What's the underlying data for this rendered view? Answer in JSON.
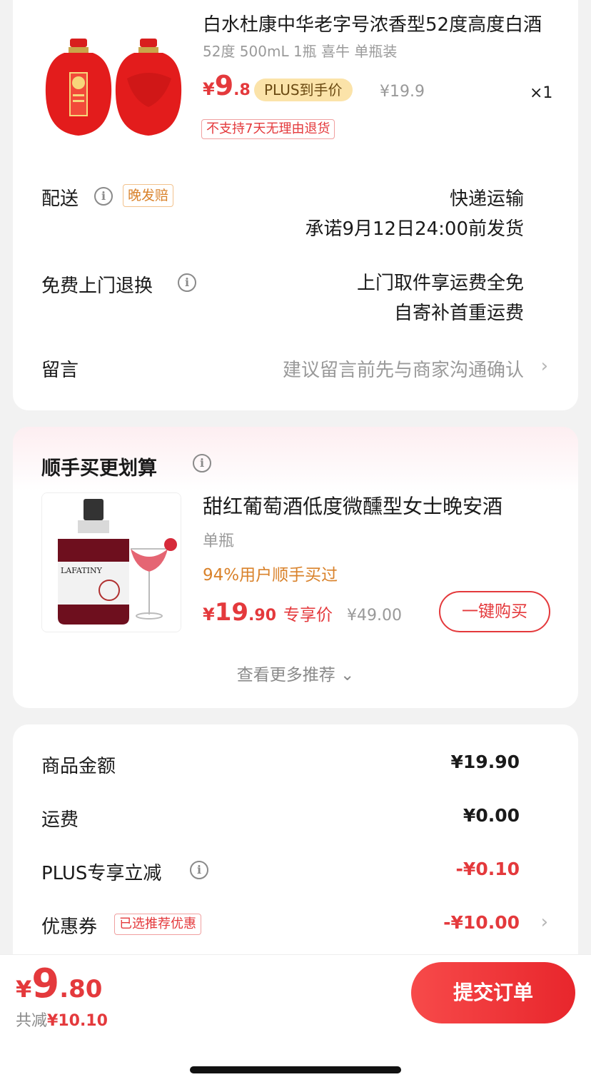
{
  "product": {
    "title": "白水杜康中华老字号浓香型52度高度白酒",
    "spec": "52度 500mL 1瓶 喜牛 单瓶装",
    "price_yen": "¥",
    "price_int": "9",
    "price_dec": ".8",
    "plus_tag": "PLUS到手价",
    "original_price": "¥19.9",
    "quantity": "×1",
    "return_notice": "不支持7天无理由退货"
  },
  "delivery": {
    "label": "配送",
    "tag": "晚发赔",
    "method": "快递运输",
    "promise": "承诺9月12日24:00前发货"
  },
  "exchange": {
    "label": "免费上门退换",
    "line1": "上门取件享运费全免",
    "line2": "自寄补首重运费"
  },
  "message": {
    "label": "留言",
    "placeholder": "建议留言前先与商家沟通确认"
  },
  "addon": {
    "section_title": "顺手买更划算",
    "name": "甜红葡萄酒低度微醺型女士晚安酒",
    "spec": "单瓶",
    "bought_ratio": "94%用户顺手买过",
    "price_yen": "¥",
    "price_int": "19",
    "price_dec": ".90",
    "price_label": "专享价",
    "original_price": "¥49.00",
    "buy_button": "一键购买",
    "more_label": "查看更多推荐 ⌄"
  },
  "summary": {
    "goods_label": "商品金额",
    "goods_value": "¥19.90",
    "shipping_label": "运费",
    "shipping_value": "¥0.00",
    "plus_label": "PLUS专享立减",
    "plus_value": "-¥0.10",
    "coupon_label": "优惠券",
    "coupon_tag": "已选推荐优惠",
    "coupon_value": "-¥10.00"
  },
  "footer": {
    "total_yen": "¥",
    "total_int": "9",
    "total_dec": ".80",
    "saved_label": "共减",
    "saved_value": "¥10.10",
    "submit_label": "提交订单"
  },
  "colors": {
    "accent_red": "#e4393c",
    "plus_gold": "#fbe3a9",
    "orange": "#d9822b"
  }
}
